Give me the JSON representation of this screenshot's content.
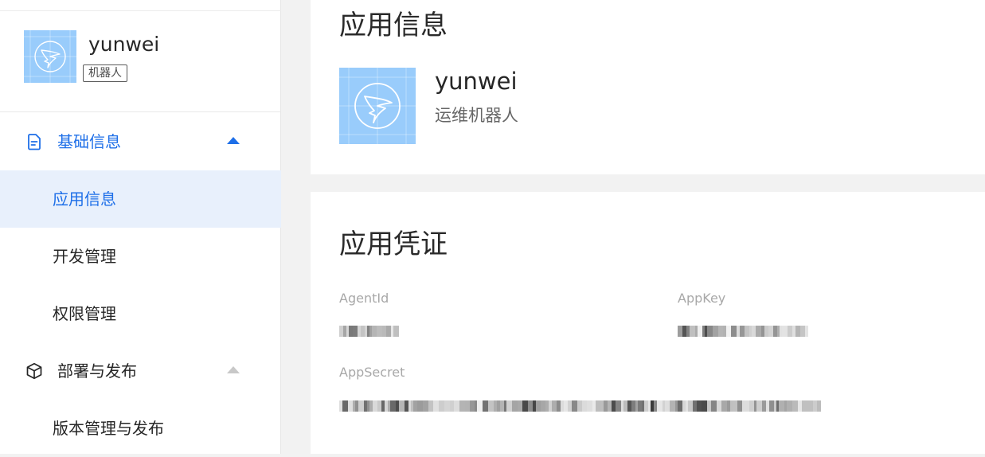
{
  "sidebar": {
    "app_name": "yunwei",
    "app_tag": "机器人",
    "groups": [
      {
        "label": "基础信息",
        "icon": "document-icon",
        "expanded": true
      },
      {
        "label": "部署与发布",
        "icon": "cube-icon",
        "expanded": true
      }
    ],
    "items": [
      {
        "label": "应用信息",
        "selected": true
      },
      {
        "label": "开发管理",
        "selected": false
      },
      {
        "label": "权限管理",
        "selected": false
      },
      {
        "label": "版本管理与发布",
        "selected": false
      }
    ]
  },
  "app_info": {
    "section_title": "应用信息",
    "app_name": "yunwei",
    "app_desc": "运维机器人"
  },
  "credentials": {
    "section_title": "应用凭证",
    "agent_id_label": "AgentId",
    "app_key_label": "AppKey",
    "app_secret_label": "AppSecret"
  },
  "colors": {
    "accent": "#1e6fe8",
    "selected_bg": "#e8f0fc",
    "logo_bg": "#99ccfb",
    "page_bg": "#f2f2f2"
  }
}
